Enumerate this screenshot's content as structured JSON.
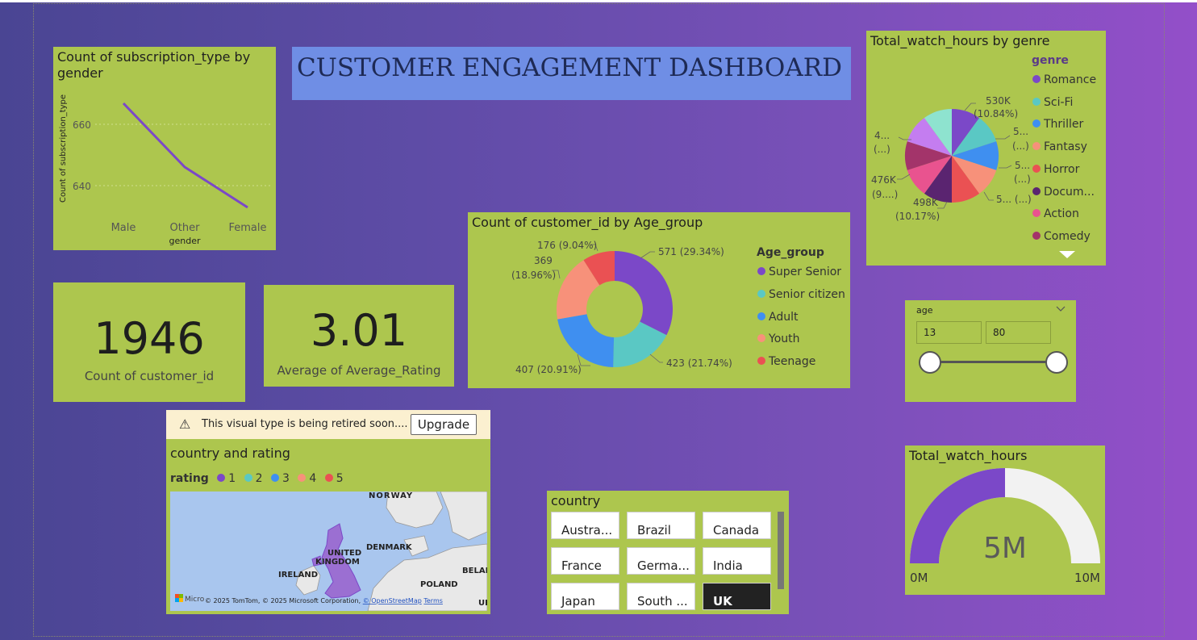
{
  "dashboard_title": "CUSTOMER ENGAGEMENT DASHBOARD",
  "line_chart": {
    "title": "Count of subscription_type by gender",
    "ylabel": "Count of subscription_type",
    "xlabel": "gender",
    "y_ticks": [
      "660",
      "640"
    ],
    "categories": [
      "Male",
      "Other",
      "Female"
    ],
    "line_color": "#7b48c8"
  },
  "kpi_count": {
    "value": "1946",
    "label": "Count of customer_id"
  },
  "kpi_rating": {
    "value": "3.01",
    "label": "Average of Average_Rating"
  },
  "donut": {
    "title": "Count of customer_id by Age_group",
    "legend_title": "Age_group",
    "labels": {
      "super_senior": "571 (29.34%)",
      "senior": "423 (21.74%)",
      "adult": "407 (20.91%)",
      "youth_line1": "369",
      "youth_line2": "(18.96%)",
      "teenage": "176 (9.04%)"
    },
    "legend": [
      "Super Senior",
      "Senior citizen",
      "Adult",
      "Youth",
      "Teenage"
    ]
  },
  "pie": {
    "title": "Total_watch_hours by genre",
    "legend_title": "genre",
    "legend": [
      "Romance",
      "Sci-Fi",
      "Thriller",
      "Fantasy",
      "Horror",
      "Docum...",
      "Action",
      "Comedy"
    ],
    "labels": {
      "top_a": "530K",
      "top_b": "(10.84%)",
      "r1a": "5...",
      "r1b": "(...)",
      "r2a": "5...",
      "r2b": "(...)",
      "r3": "5... (...)",
      "bot_a": "498K",
      "bot_b": "(10.17%)",
      "l1a": "476K",
      "l1b": "(9....)",
      "l2a": "4...",
      "l2b": "(...)"
    }
  },
  "age_slicer": {
    "label": "age",
    "min": "13",
    "max": "80"
  },
  "map": {
    "warning": "This visual type is being retired soon....",
    "upgrade": "Upgrade",
    "title": "country and rating",
    "legend_title": "rating",
    "legend": [
      "1",
      "2",
      "3",
      "4",
      "5"
    ],
    "places": {
      "norway": "NORWAY",
      "denmark": "DENMARK",
      "uk1": "UNITED",
      "uk2": "KINGDOM",
      "ireland": "IRELAND",
      "poland": "POLAND",
      "belarus": "BELAI",
      "uk_edge": "UK"
    },
    "ms_logo": "Micro",
    "attribution": "© 2025 TomTom, © 2025 Microsoft Corporation, ",
    "osm": "© OpenStreetMap",
    "terms": "Terms"
  },
  "country_slicer": {
    "title": "country",
    "options": [
      "Austra...",
      "Brazil",
      "Canada",
      "France",
      "Germa...",
      "India",
      "Japan",
      "South ...",
      "UK"
    ],
    "selected": "UK"
  },
  "gauge": {
    "title": "Total_watch_hours",
    "value_label": "5M",
    "min": "0M",
    "max": "10M",
    "fraction": 0.5
  },
  "colors": {
    "tile": "#adc64e",
    "purple": "#7b48c8",
    "teal": "#5ac8c4",
    "blue": "#3f8ff0",
    "salmon": "#f7917a",
    "red": "#ea5153",
    "darkpurple": "#5a2470",
    "pink": "#e9538f",
    "maroon": "#a3346a",
    "lavender": "#c47df0",
    "mint": "#8ee3cf"
  }
}
